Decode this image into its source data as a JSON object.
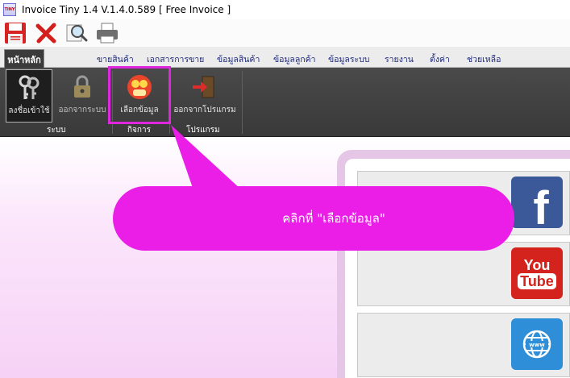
{
  "window": {
    "title": "Invoice Tiny 1.4  V.1.4.0.589 [ Free Invoice ]",
    "logo_text": "TINY"
  },
  "toolbar": {
    "buttons": [
      {
        "name": "save",
        "icon": "floppy-disk-icon"
      },
      {
        "name": "delete",
        "icon": "red-x-icon"
      },
      {
        "name": "preview",
        "icon": "magnifier-icon"
      },
      {
        "name": "print",
        "icon": "printer-icon"
      }
    ]
  },
  "menu": {
    "home_tab": "หน้าหลัก",
    "items": [
      "ขายสินค้า",
      "เอกสารการขาย",
      "ข้อมูลสินค้า",
      "ข้อมูลลูกค้า",
      "ข้อมูลระบบ",
      "รายงาน",
      "ตั้งค่า",
      "ช่วยเหลือ"
    ]
  },
  "ribbon": {
    "login": "ลงชื่อเข้าใช้",
    "logout": "ออกจากระบบ",
    "select_data": "เลือกข้อมูล",
    "exit_program": "ออกจากโปรแกรม",
    "groups": {
      "system": "ระบบ",
      "business": "กิจการ",
      "program": "โปรแกรม"
    }
  },
  "social": {
    "facebook_letter": "f",
    "youtube_you": "You",
    "youtube_tube": "Tube"
  },
  "callout": {
    "text": "คลิกที่ \"เลือกข้อมูล\""
  },
  "colors": {
    "accent_magenta": "#ea1ee6",
    "ribbon_bg": "#3f3f3f",
    "facebook": "#3b5998",
    "youtube": "#d4231c",
    "web": "#2f8ed8"
  }
}
